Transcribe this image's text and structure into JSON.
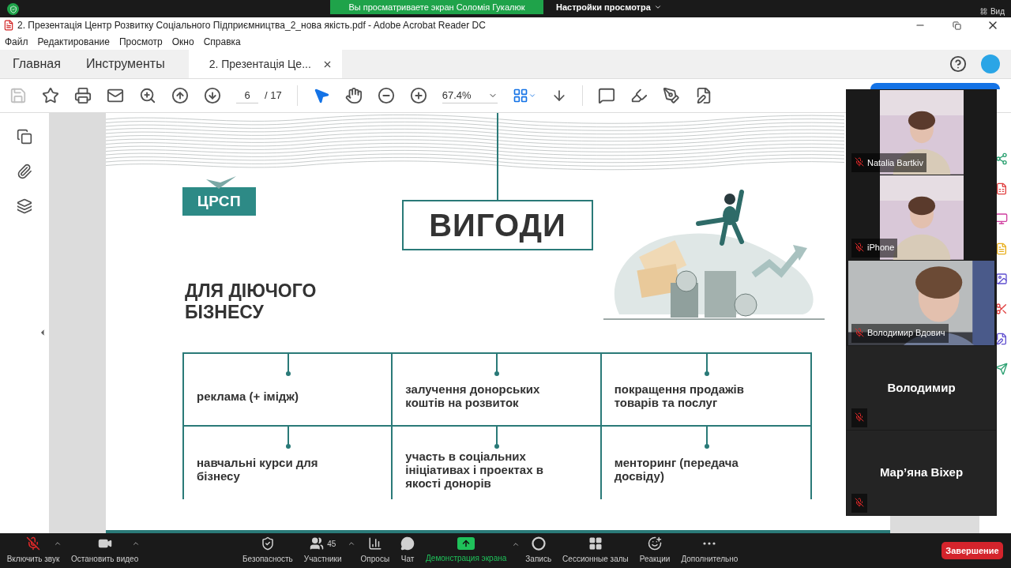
{
  "zoom_top": {
    "banner": "Вы просматриваете экран Соломія Гукалюк",
    "view_settings": "Настройки просмотра",
    "view": "Вид"
  },
  "window": {
    "title": "2. Презентація Центр Розвитку Соціального Підприємництва_2_нова якість.pdf - Adobe Acrobat Reader DC"
  },
  "menu": [
    "Файл",
    "Редактирование",
    "Просмотр",
    "Окно",
    "Справка"
  ],
  "tabs": [
    {
      "label": "Главная",
      "selected": false
    },
    {
      "label": "Инструменты",
      "selected": false
    },
    {
      "label": "2. Презентація Це...",
      "selected": true
    }
  ],
  "toolbar": {
    "save_disabled": true,
    "page": "6",
    "pages": "/ 17",
    "zoom": "67.4%",
    "tools": [
      {
        "kind": "select",
        "selected": true
      },
      {
        "kind": "hand",
        "selected": false
      }
    ]
  },
  "slide": {
    "logo": "ЦРСП",
    "title": "ВИГОДИ",
    "subtitle": "ДЛЯ ДІЮЧОГО БІЗНЕСУ",
    "cells": [
      "реклама (+ імідж)",
      "залучення донорських коштів на розвиток",
      "покращення продажів товарів та послуг",
      "навчальні курси для бізнесу",
      "участь в соціальних ініціативах і проектах в якості донорів",
      "менторинг (передача досвіду)"
    ]
  },
  "participants": [
    {
      "name": "Natalia Bartkiv",
      "kind": "video",
      "muted": true
    },
    {
      "name": "iPhone",
      "kind": "video",
      "muted": true
    },
    {
      "name": "Володимир Вдович",
      "kind": "wide",
      "muted": true
    },
    {
      "name": "Володимир",
      "kind": "name",
      "muted": true
    },
    {
      "name": "Мар’яна Віхер",
      "kind": "name",
      "muted": true
    }
  ],
  "bottom_bar": {
    "left": [
      {
        "label": "Включить звук",
        "kind": "mic",
        "muted": true
      },
      {
        "label": "Остановить видео",
        "kind": "video",
        "muted": false
      }
    ],
    "center": [
      {
        "label": "Безопасность",
        "kind": "security",
        "active": false
      },
      {
        "label": "Участники",
        "kind": "participants",
        "count": "45",
        "active": false
      },
      {
        "label": "Опросы",
        "kind": "polls",
        "active": false
      },
      {
        "label": "Чат",
        "kind": "chat",
        "active": false
      },
      {
        "label": "Демонстрация экрана",
        "kind": "share",
        "active": true
      },
      {
        "label": "Запись",
        "kind": "record",
        "active": false
      },
      {
        "label": "Сессионные залы",
        "kind": "rooms",
        "active": false
      },
      {
        "label": "Реакции",
        "kind": "reactions",
        "active": false
      },
      {
        "label": "Дополнительно",
        "kind": "more",
        "active": false
      }
    ],
    "end": "Завершение"
  }
}
